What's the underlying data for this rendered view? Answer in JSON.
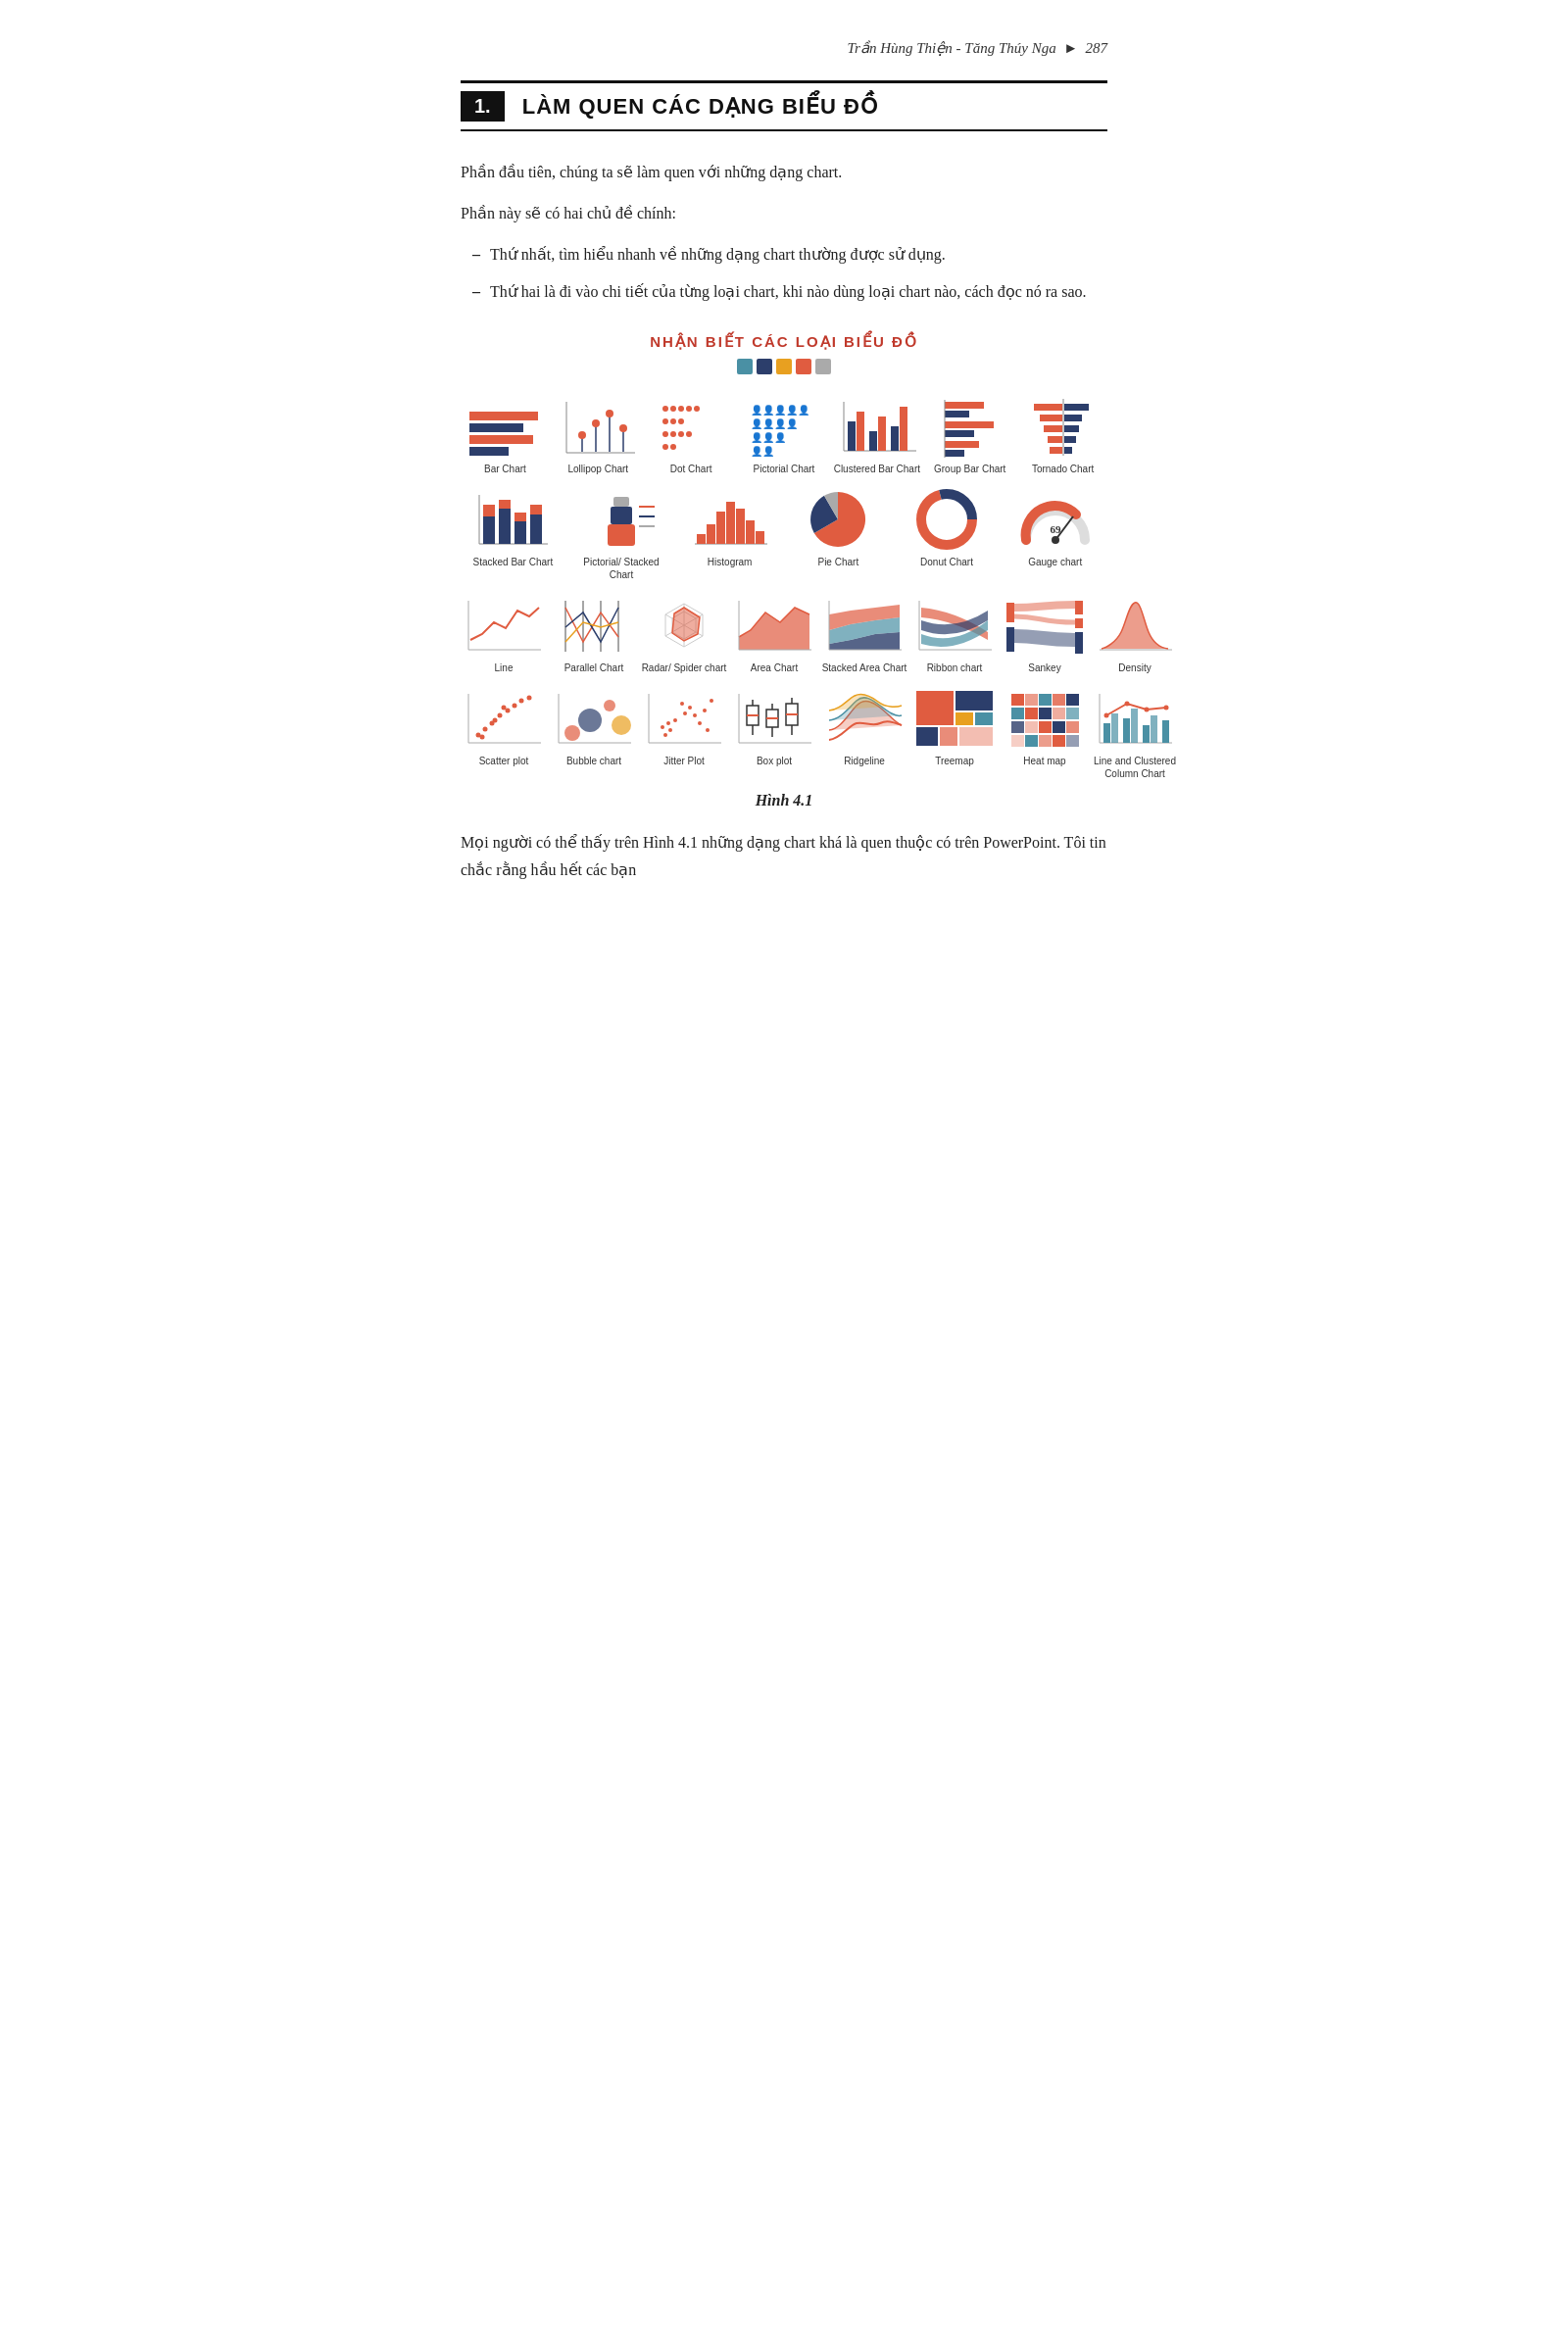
{
  "header": {
    "text": "Trần Hùng Thiện - Tăng Thúy Nga",
    "page": "287"
  },
  "chapter": {
    "number": "1.",
    "title": "LÀM QUEN CÁC DẠNG BIỂU ĐỒ"
  },
  "paragraphs": [
    "Phần đầu tiên, chúng ta sẽ làm quen với những dạng chart.",
    "Phần này sẽ có hai chủ đề chính:"
  ],
  "bullets": [
    "Thứ nhất, tìm hiểu nhanh về những dạng chart thường được sử dụng.",
    "Thứ hai là đi vào chi tiết của từng loại chart, khi nào dùng loại chart nào, cách đọc nó ra sao."
  ],
  "section_title": "NHẬN BIẾT CÁC LOẠI BIỂU ĐỒ",
  "colors": [
    "#4a90a4",
    "#2c3e6b",
    "#e8a020",
    "#e05c40",
    "#aaa"
  ],
  "rows": [
    {
      "charts": [
        {
          "label": "Bar Chart"
        },
        {
          "label": "Lollipop Chart"
        },
        {
          "label": "Dot Chart"
        },
        {
          "label": "Pictorial Chart"
        },
        {
          "label": "Clustered Bar Chart"
        },
        {
          "label": "Group Bar Chart"
        },
        {
          "label": "Tornado Chart"
        }
      ]
    },
    {
      "charts": [
        {
          "label": "Stacked Bar Chart"
        },
        {
          "label": "Pictorial/ Stacked Chart"
        },
        {
          "label": "Histogram"
        },
        {
          "label": "Pie Chart"
        },
        {
          "label": "Donut Chart"
        },
        {
          "label": "Gauge chart"
        }
      ]
    },
    {
      "charts": [
        {
          "label": "Line"
        },
        {
          "label": "Parallel Chart"
        },
        {
          "label": "Radar/ Spider chart"
        },
        {
          "label": "Area Chart"
        },
        {
          "label": "Stacked Area Chart"
        },
        {
          "label": "Ribbon chart"
        },
        {
          "label": "Sankey"
        },
        {
          "label": "Density"
        }
      ]
    },
    {
      "charts": [
        {
          "label": "Scatter plot"
        },
        {
          "label": "Bubble chart"
        },
        {
          "label": "Jitter Plot"
        },
        {
          "label": "Box plot"
        },
        {
          "label": "Ridgeline"
        },
        {
          "label": "Treemap"
        },
        {
          "label": "Heat map"
        },
        {
          "label": "Line and Clustered Column Chart"
        }
      ]
    }
  ],
  "caption": "Hình 4.1",
  "footer_text": "Mọi người có thể thấy trên Hình 4.1 những dạng chart khá là quen thuộc có trên PowerPoint. Tôi tin chắc rằng hầu hết các bạn"
}
